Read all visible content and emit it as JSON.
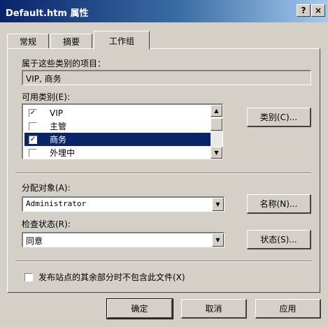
{
  "window": {
    "title": "Default.htm 属性",
    "help_label": "?",
    "close_label": "×"
  },
  "tabs": [
    {
      "label": "常规",
      "active": false
    },
    {
      "label": "摘要",
      "active": false
    },
    {
      "label": "工作组",
      "active": true
    }
  ],
  "workgroup": {
    "belongs_label": "属于这些类别的项目：",
    "belongs_value": "VIP, 商务",
    "available_label": "可用类别(E):",
    "categories": [
      {
        "label": "VIP",
        "checked": true,
        "selected": false
      },
      {
        "label": "主管",
        "checked": false,
        "selected": false
      },
      {
        "label": "商务",
        "checked": true,
        "selected": true
      },
      {
        "label": "外埋中",
        "checked": false,
        "selected": false
      }
    ],
    "categories_button": "类别(C)...",
    "assigned_label": "分配对象(A):",
    "assigned_value": "Administrator",
    "names_button": "名称(N)...",
    "review_label": "检查状态(R):",
    "review_value": "同意",
    "status_button": "状态(S)...",
    "exclude_label": "发布站点的其余部分时不包含此文件(X)",
    "exclude_checked": false
  },
  "footer": {
    "ok": "确定",
    "cancel": "取消",
    "apply": "应用"
  },
  "colors": {
    "face": "#d4d0c8",
    "selection": "#0a246a",
    "title_start": "#0a246a"
  }
}
